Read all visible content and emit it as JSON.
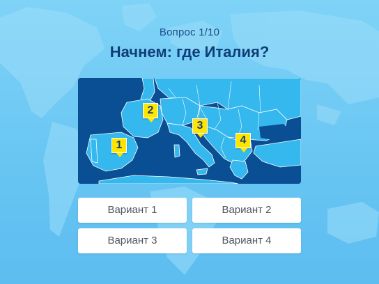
{
  "header": {
    "counter": "Вопрос 1/10",
    "question": "Начнем: где Италия?"
  },
  "map": {
    "markers": [
      "1",
      "2",
      "3",
      "4"
    ],
    "colors": {
      "sea": "#0a4f93",
      "land": "#35b8ee",
      "border": "#ffffff",
      "marker": "#ffe600"
    }
  },
  "answers": [
    "Вариант 1",
    "Вариант 2",
    "Вариант 3",
    "Вариант 4"
  ],
  "colors": {
    "title": "#0f3e78",
    "counter": "#1b4f86",
    "answer_text": "#4d5560"
  }
}
